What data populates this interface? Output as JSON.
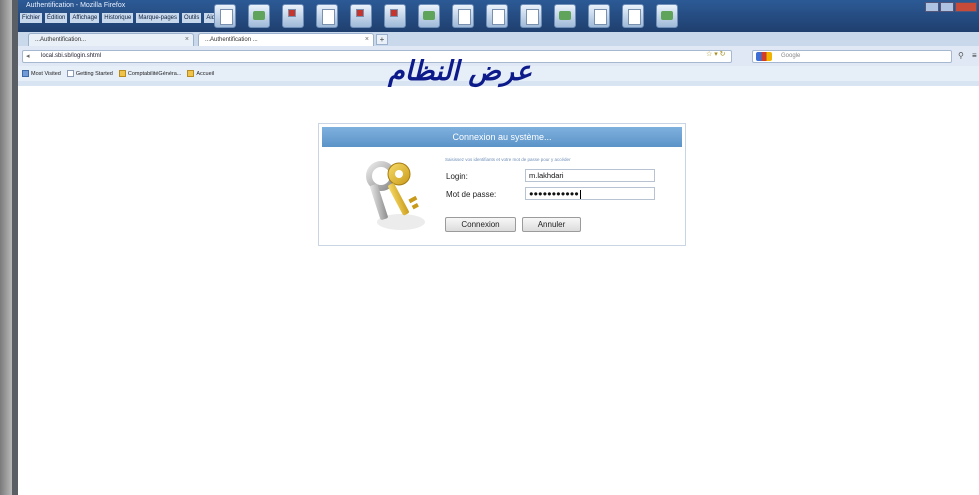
{
  "window": {
    "title": "Authentification - Mozilla Firefox",
    "menus": [
      "Fichier",
      "Édition",
      "Affichage",
      "Historique",
      "Marque-pages",
      "Outils",
      "Aide"
    ]
  },
  "tabs": [
    {
      "label": "...Authentification..."
    },
    {
      "label": "...Authentification ..."
    }
  ],
  "newtab_label": "+",
  "address_bar": {
    "url": "local.sbi.sb/login.shtml",
    "search_placeholder": "Google"
  },
  "bookmarks": [
    "Most Visited",
    "Getting Started",
    "ComptabilitéGénéra...",
    "Accueil"
  ],
  "caption_arabic": "عرض النظام",
  "login": {
    "header": "Connexion au système...",
    "instruction": "Saisissez vos identifiants et votre mot de passe pour y accéder",
    "login_label": "Login:",
    "login_value": "m.lakhdari",
    "password_label": "Mot de passe:",
    "password_value": "●●●●●●●●●●●",
    "connect_button": "Connexion",
    "cancel_button": "Annuler"
  },
  "colors": {
    "header_blue": "#5b93c8",
    "caption_text": "#0c1a8a"
  }
}
